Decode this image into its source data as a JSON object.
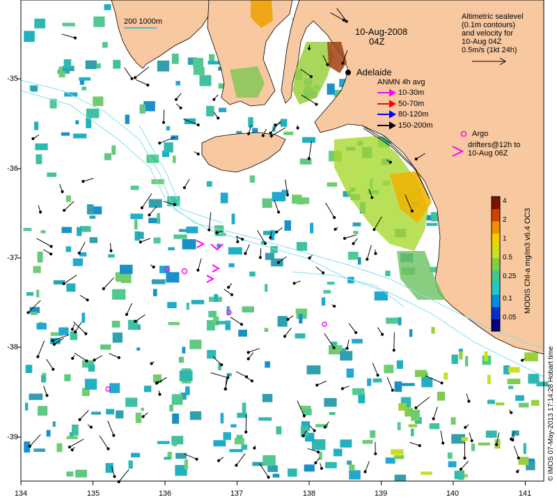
{
  "header": {
    "date": "10-Aug-2008",
    "time": "04Z"
  },
  "scale": {
    "label": "200  1000m"
  },
  "city": {
    "name": "Adelaide"
  },
  "altimetry_note": [
    "Altimetric sealevel",
    "(0.1m contours)",
    "and velocity for",
    "10-Aug 04Z",
    "0.5m/s (1kt 24h)"
  ],
  "anmn": {
    "title": "ANMN 4h avg",
    "items": [
      {
        "label": "10-30m",
        "color": "#ff00ff"
      },
      {
        "label": "50-70m",
        "color": "#ff0000"
      },
      {
        "label": "80-120m",
        "color": "#0000ff"
      },
      {
        "label": "150-200m",
        "color": "#000000"
      }
    ]
  },
  "argo": {
    "label": "Argo",
    "color": "#ff00ff"
  },
  "drifters": {
    "label_line1": "drifters@12h to",
    "label_line2": "10-Aug 06Z",
    "color": "#ff00ff"
  },
  "colorbar": {
    "title": "MODIS Chl-a mg/m3 v6.4 OC3",
    "ticks": [
      "4",
      "2",
      "1",
      "0.5",
      "0.25",
      "0.1",
      "0.05"
    ],
    "colors": [
      "#08007a",
      "#0030d0",
      "#0090e0",
      "#20c8c8",
      "#40c890",
      "#80d040",
      "#c8e020",
      "#f0d000",
      "#f09000",
      "#d04000",
      "#801000"
    ]
  },
  "credit": "© IMOS 07-May-2013 17:14:28 Hobart time",
  "axes": {
    "x_ticks": [
      "134",
      "135",
      "136",
      "137",
      "138",
      "139",
      "140",
      "141"
    ],
    "y_ticks": [
      "-35",
      "-36",
      "-37",
      "-38",
      "-39"
    ]
  },
  "colors": {
    "land": "#f8c8a0",
    "ocean": "#ffffff",
    "contour": "#80e0f0"
  }
}
